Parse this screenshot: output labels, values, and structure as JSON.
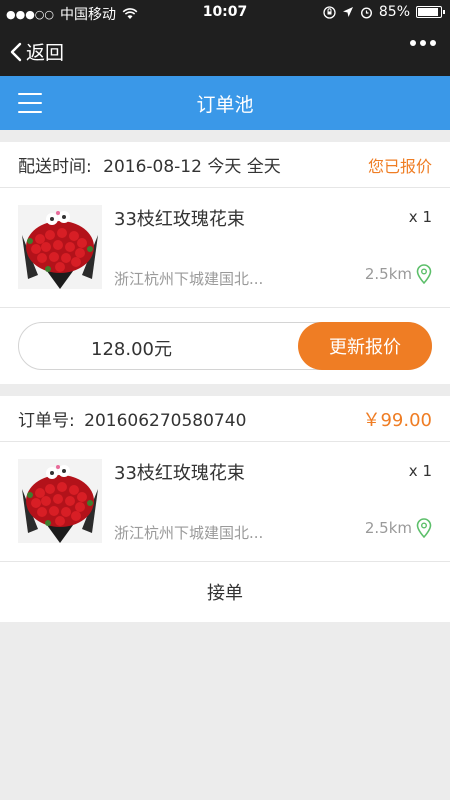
{
  "status_bar": {
    "carrier": "中国移动",
    "time": "10:07",
    "battery": "85%"
  },
  "wechat_bar": {
    "back_label": "返回"
  },
  "app_bar": {
    "title": "订单池"
  },
  "orders": [
    {
      "header_label": "配送时间:",
      "header_value": "2016-08-12  今天  全天",
      "header_right": "您已报价",
      "product_name": "33枝红玫瑰花束",
      "quantity": "x 1",
      "address": "浙江杭州下城建国北...",
      "distance": "2.5km",
      "quote_value": "128.00元",
      "update_label": "更新报价"
    },
    {
      "header_label": "订单号:",
      "header_value": "201606270580740",
      "header_right": "￥99.00",
      "product_name": "33枝红玫瑰花束",
      "quantity": "x 1",
      "address": "浙江杭州下城建国北...",
      "distance": "2.5km",
      "accept_label": "接单"
    }
  ],
  "icons": {
    "location": "location-pin-icon",
    "menu": "hamburger-menu-icon",
    "back": "chevron-left-icon",
    "more": "more-dots-icon"
  },
  "colors": {
    "accent": "#ef7d24",
    "app_bar": "#3a98e8",
    "location_pin": "#5cbf6a"
  }
}
